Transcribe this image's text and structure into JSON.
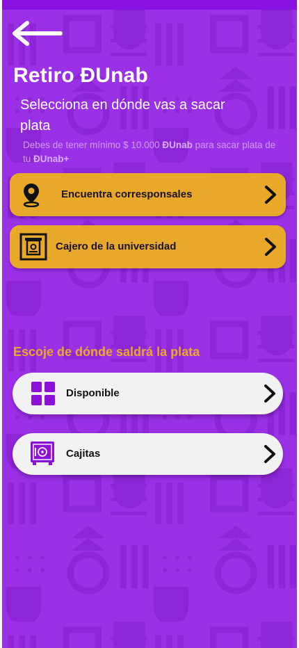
{
  "header": {
    "title": "Retiro ĐUnab",
    "subtitle": "Selecciona en dónde vas a sacar plata",
    "note_prefix": "Debes de tener mínimo $ 10.000",
    "note_brand": "ĐUnab",
    "note_middle": "para sacar plata de tu",
    "note_brand_plus": "ĐUnab+"
  },
  "withdraw_options": [
    {
      "label": "Encuentra corresponsales",
      "icon": "location-pin-icon"
    },
    {
      "label": "Cajero de la universidad",
      "icon": "atm-icon"
    }
  ],
  "source_section": {
    "title": "Escoje de dónde saldrá la plata",
    "options": [
      {
        "label": "Disponible",
        "icon": "grid-icon"
      },
      {
        "label": "Cajitas",
        "icon": "safe-icon"
      }
    ]
  },
  "colors": {
    "background": "#9a31e6",
    "top_bar": "#8a12e0",
    "accent": "#e8a92b",
    "card": "#f2f2f2",
    "icon_purple": "#8c10d8"
  }
}
